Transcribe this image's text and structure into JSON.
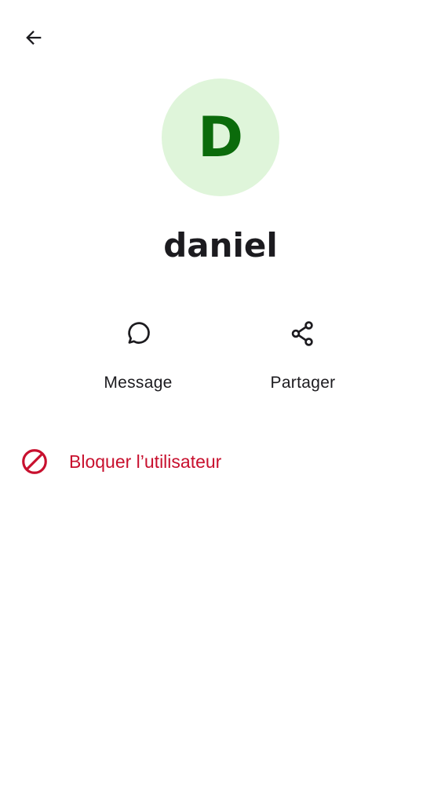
{
  "header": {
    "back_icon": "arrow-left-icon"
  },
  "profile": {
    "avatar_letter": "D",
    "avatar_bg_color": "#dff5da",
    "avatar_fg_color": "#0b6b0b",
    "name": "daniel"
  },
  "actions": [
    {
      "label": "Message",
      "icon": "chat-bubble-icon"
    },
    {
      "label": "Partager",
      "icon": "share-icon"
    }
  ],
  "block": {
    "label": "Bloquer l’utilisateur",
    "icon": "block-icon",
    "color": "#c8102e"
  }
}
